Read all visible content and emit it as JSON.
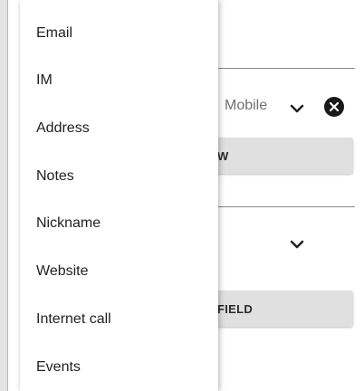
{
  "background": {
    "phone_type": "Mobile",
    "truncated_button_1": "W",
    "add_field_button": "FIELD"
  },
  "menu": {
    "items": [
      {
        "label": "Email"
      },
      {
        "label": "IM"
      },
      {
        "label": "Address"
      },
      {
        "label": "Notes"
      },
      {
        "label": "Nickname"
      },
      {
        "label": "Website"
      },
      {
        "label": "Internet call"
      },
      {
        "label": "Events"
      }
    ]
  },
  "icons": {
    "dropdown": "chevron-down-icon",
    "clear": "close-circle-icon"
  },
  "colors": {
    "menu_bg": "#ffffff",
    "button_bg": "#e0e0e0",
    "text": "#212121",
    "muted_text": "#6f6f6f"
  }
}
